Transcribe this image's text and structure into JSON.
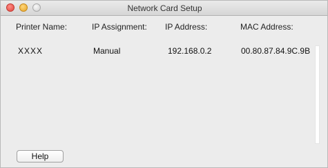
{
  "window": {
    "title": "Network Card Setup"
  },
  "table": {
    "headers": [
      "Printer Name:",
      "IP Assignment:",
      "IP Address:",
      "MAC Address:"
    ],
    "rows": [
      [
        "XXXX",
        "Manual",
        "192.168.0.2",
        "00.80.87.84.9C.9B"
      ]
    ]
  },
  "help_button": {
    "label": "Help"
  }
}
